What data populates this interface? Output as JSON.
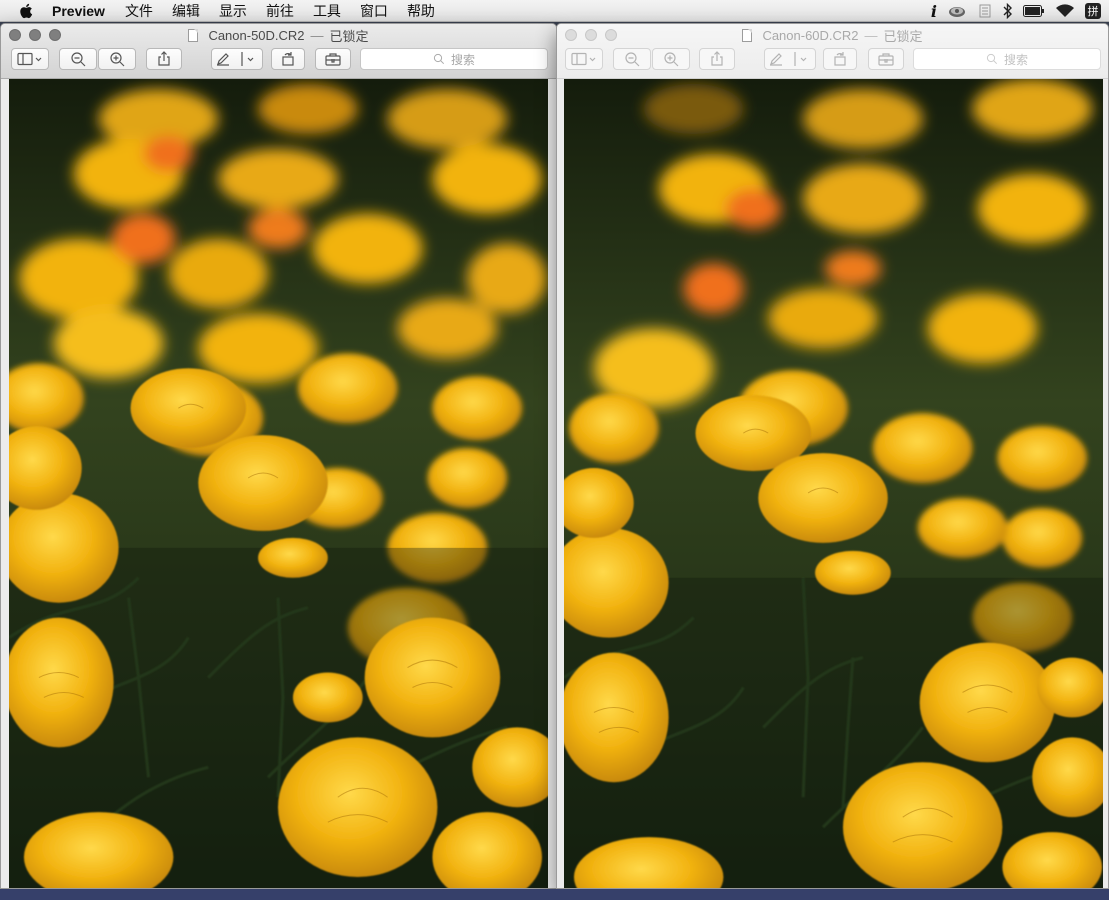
{
  "menubar": {
    "app_name": "Preview",
    "items": [
      "文件",
      "编辑",
      "显示",
      "前往",
      "工具",
      "窗口",
      "帮助"
    ],
    "status_icons": [
      "info-icon",
      "cloud-icon",
      "app-icon",
      "bluetooth-icon",
      "battery-icon",
      "wifi-icon",
      "input-method-icon"
    ],
    "input_method_label": "拼"
  },
  "windows": [
    {
      "file_name": "Canon-50D.CR2",
      "separator": "—",
      "status": "已锁定",
      "search_placeholder": "搜索",
      "active": true
    },
    {
      "file_name": "Canon-60D.CR2",
      "separator": "—",
      "status": "已锁定",
      "search_placeholder": "搜索",
      "active": false
    }
  ],
  "photo": {
    "subject": "marigold-flowers",
    "colors": {
      "petal": "#f2b311",
      "petal_light": "#ffd33a",
      "petal_dark": "#c98a08",
      "orange": "#f06f1e",
      "foliage": "#2b3a1d",
      "shadow": "#101a0a"
    }
  }
}
